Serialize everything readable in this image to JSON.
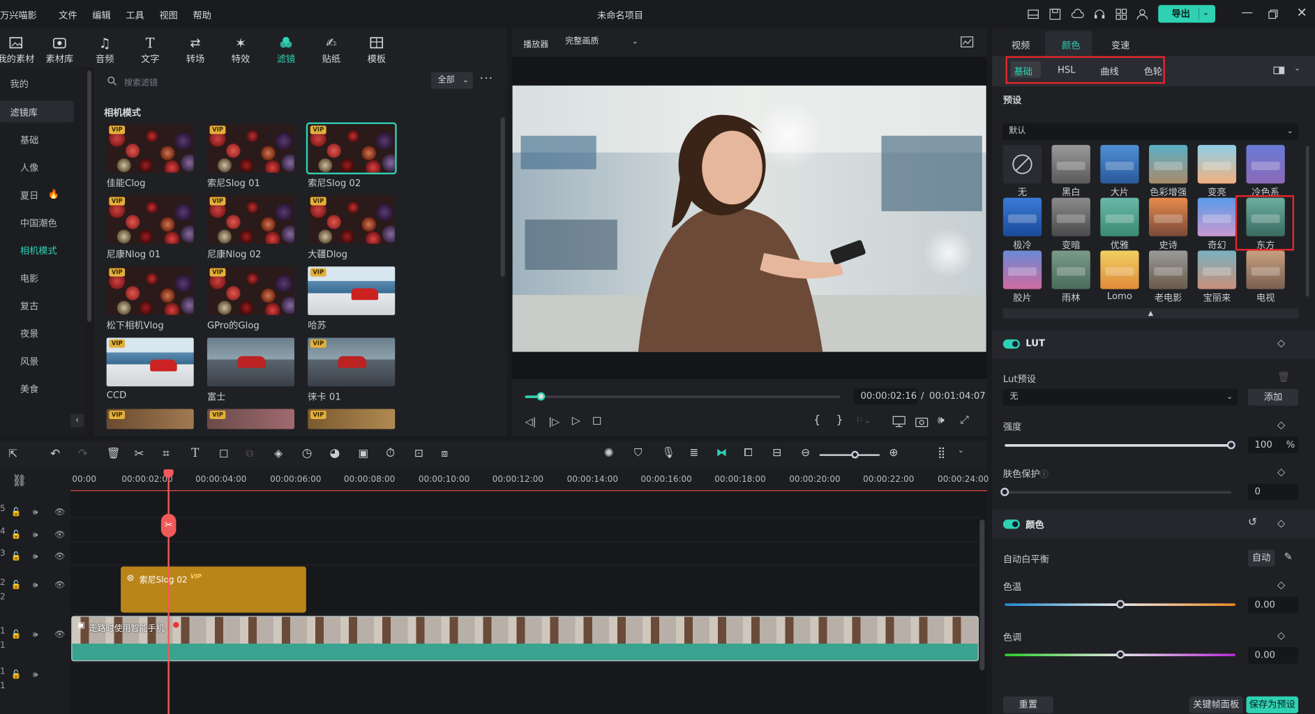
{
  "app": {
    "name": "万兴喵影",
    "project_title": "未命名项目",
    "export_label": "导出"
  },
  "menu": [
    "文件",
    "编辑",
    "工具",
    "视图",
    "帮助"
  ],
  "media_tabs": [
    {
      "label": "我的素材"
    },
    {
      "label": "素材库"
    },
    {
      "label": "音频"
    },
    {
      "label": "文字"
    },
    {
      "label": "转场"
    },
    {
      "label": "特效"
    },
    {
      "label": "滤镜",
      "active": true
    },
    {
      "label": "贴纸"
    },
    {
      "label": "模板"
    }
  ],
  "left_nav": {
    "mine": "我的",
    "library": "滤镜库",
    "items": [
      "基础",
      "人像",
      "夏日",
      "中国潮色",
      "相机模式",
      "电影",
      "复古",
      "夜景",
      "风景",
      "美食"
    ],
    "selected": "相机模式"
  },
  "filter_panel": {
    "search_placeholder": "搜索滤镜",
    "scope": "全部",
    "section_title": "相机模式",
    "filters": [
      {
        "name": "佳能Clog",
        "vip": true
      },
      {
        "name": "索尼Slog 01",
        "vip": true
      },
      {
        "name": "索尼Slog 02",
        "vip": true,
        "selected": true
      },
      {
        "name": "尼康Nlog 01",
        "vip": true
      },
      {
        "name": "尼康Nlog 02",
        "vip": true
      },
      {
        "name": "大疆Dlog",
        "vip": true
      },
      {
        "name": "松下相机Vlog",
        "vip": true
      },
      {
        "name": "GPro的Glog",
        "vip": true
      },
      {
        "name": "哈苏",
        "vip": true
      },
      {
        "name": "CCD",
        "vip": true
      },
      {
        "name": "富士",
        "vip": false
      },
      {
        "name": "徕卡 01",
        "vip": true
      }
    ],
    "vip_badge": "VIP"
  },
  "player": {
    "label": "播放器",
    "quality": "完整画质",
    "current_time": "00:00:02:16",
    "separator": "/",
    "total_time": "00:01:04:07",
    "progress": 0.05
  },
  "right_panel": {
    "tabs": [
      "视频",
      "颜色",
      "变速"
    ],
    "active_tab": "颜色",
    "subtabs": [
      "基础",
      "HSL",
      "曲线",
      "色轮"
    ],
    "active_subtab": "基础",
    "preset_title": "预设",
    "preset_dropdown": "默认",
    "presets": [
      "无",
      "黑白",
      "大片",
      "色彩增强",
      "变亮",
      "冷色系",
      "极冷",
      "变暗",
      "优雅",
      "史诗",
      "奇幻",
      "东方",
      "胶片",
      "雨林",
      "Lomo",
      "老电影",
      "宝丽来",
      "电视"
    ],
    "selected_preset": "东方",
    "lut": {
      "title": "LUT",
      "preset_label": "Lut预设",
      "value": "无",
      "add": "添加",
      "strength_label": "强度",
      "strength": 100,
      "percent": "%",
      "skin_label": "肤色保护",
      "skin": 0
    },
    "color": {
      "title": "颜色",
      "awb_label": "自动白平衡",
      "auto": "自动",
      "temp_label": "色温",
      "temp": "0.00",
      "tint_label": "色调",
      "tint": "0.00"
    },
    "reset": "重置",
    "keyframe": "关键帧面板",
    "save_preset": "保存为预设"
  },
  "timeline": {
    "ticks": [
      "00:00",
      "00:00:02:00",
      "00:00:04:00",
      "00:00:06:00",
      "00:00:08:00",
      "00:00:10:00",
      "00:00:12:00",
      "00:00:14:00",
      "00:00:16:00",
      "00:00:18:00",
      "00:00:20:00",
      "00:00:22:00",
      "00:00:24:00"
    ],
    "filter_clip": "索尼Slog 02",
    "video_clip": "走路时使用智能手机",
    "track_labels": [
      "5",
      "4",
      "3",
      "2",
      "2",
      "1",
      "1",
      "1",
      "1"
    ]
  }
}
